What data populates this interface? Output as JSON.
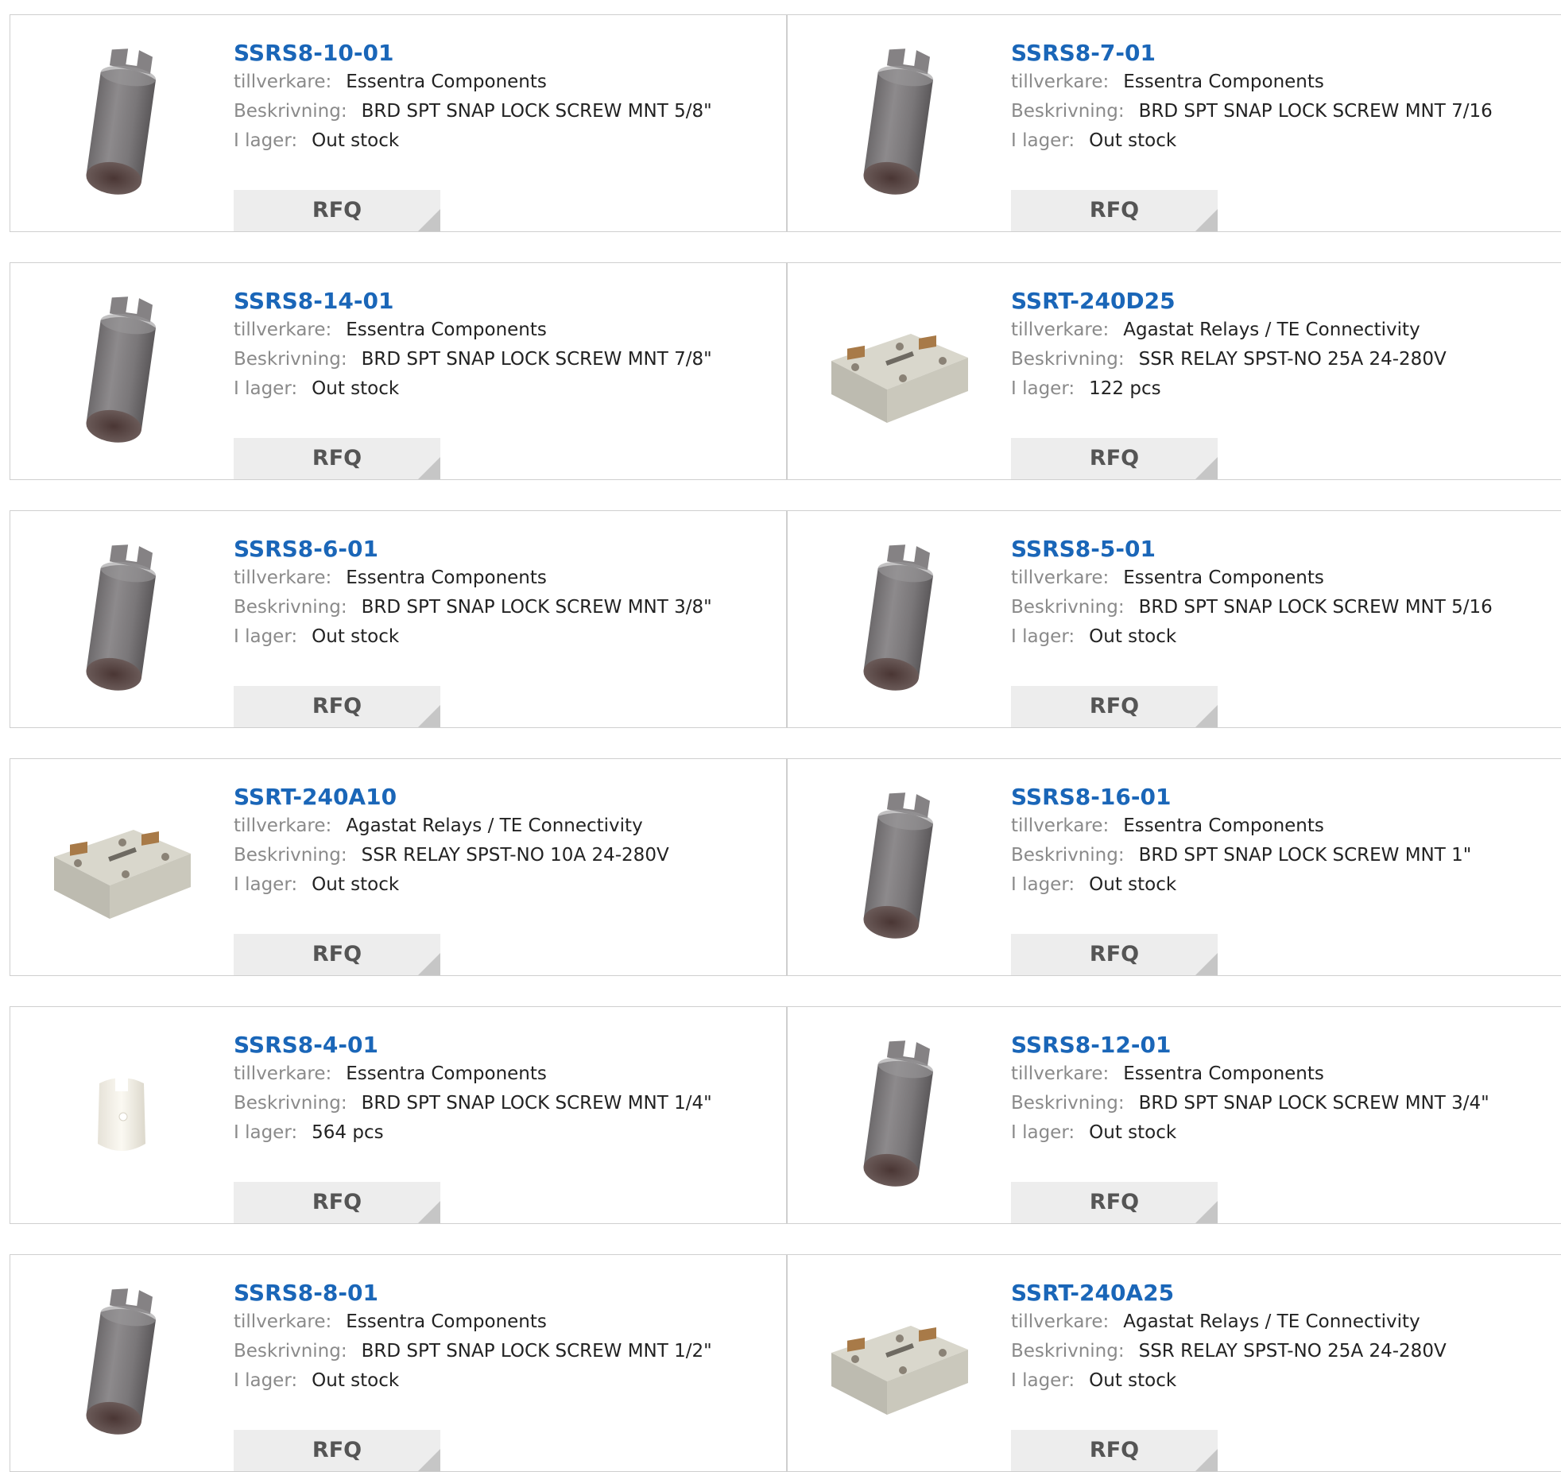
{
  "labels": {
    "manufacturer": "tillverkare:",
    "description": "Beskrivning:",
    "stock": "I lager:",
    "rfq": "RFQ"
  },
  "products": [
    {
      "name": "SSRS8-10-01",
      "manufacturer": "Essentra Components",
      "description": "BRD SPT SNAP LOCK SCREW MNT 5/8\"",
      "stock": "Out stock",
      "image": "grey-spacer-image"
    },
    {
      "name": "SSRS8-7-01",
      "manufacturer": "Essentra Components",
      "description": "BRD SPT SNAP LOCK SCREW MNT 7/16",
      "stock": "Out stock",
      "image": "grey-spacer-image"
    },
    {
      "name": "SSRS8-14-01",
      "manufacturer": "Essentra Components",
      "description": "BRD SPT SNAP LOCK SCREW MNT 7/8\"",
      "stock": "Out stock",
      "image": "grey-spacer-image"
    },
    {
      "name": "SSRT-240D25",
      "manufacturer": "Agastat Relays / TE Connectivity",
      "description": "SSR RELAY SPST-NO 25A 24-280V",
      "stock": "122 pcs",
      "image": "relay-image"
    },
    {
      "name": "SSRS8-6-01",
      "manufacturer": "Essentra Components",
      "description": "BRD SPT SNAP LOCK SCREW MNT 3/8\"",
      "stock": "Out stock",
      "image": "grey-spacer-image"
    },
    {
      "name": "SSRS8-5-01",
      "manufacturer": "Essentra Components",
      "description": "BRD SPT SNAP LOCK SCREW MNT 5/16",
      "stock": "Out stock",
      "image": "grey-spacer-image"
    },
    {
      "name": "SSRT-240A10",
      "manufacturer": "Agastat Relays / TE Connectivity",
      "description": "SSR RELAY SPST-NO 10A 24-280V",
      "stock": "Out stock",
      "image": "relay-image"
    },
    {
      "name": "SSRS8-16-01",
      "manufacturer": "Essentra Components",
      "description": "BRD SPT SNAP LOCK SCREW MNT 1\"",
      "stock": "Out stock",
      "image": "grey-spacer-image"
    },
    {
      "name": "SSRS8-4-01",
      "manufacturer": "Essentra Components",
      "description": "BRD SPT SNAP LOCK SCREW MNT 1/4\"",
      "stock": "564 pcs",
      "image": "white-spacer-image"
    },
    {
      "name": "SSRS8-12-01",
      "manufacturer": "Essentra Components",
      "description": "BRD SPT SNAP LOCK SCREW MNT 3/4\"",
      "stock": "Out stock",
      "image": "grey-spacer-image"
    },
    {
      "name": "SSRS8-8-01",
      "manufacturer": "Essentra Components",
      "description": "BRD SPT SNAP LOCK SCREW MNT 1/2\"",
      "stock": "Out stock",
      "image": "grey-spacer-image"
    },
    {
      "name": "SSRT-240A25",
      "manufacturer": "Agastat Relays / TE Connectivity",
      "description": "SSR RELAY SPST-NO 25A 24-280V",
      "stock": "Out stock",
      "image": "relay-image"
    }
  ],
  "colors": {
    "link": "#1a66b8",
    "label": "#8a8a8a",
    "border": "#cfcfcf",
    "button": "#ededed"
  }
}
